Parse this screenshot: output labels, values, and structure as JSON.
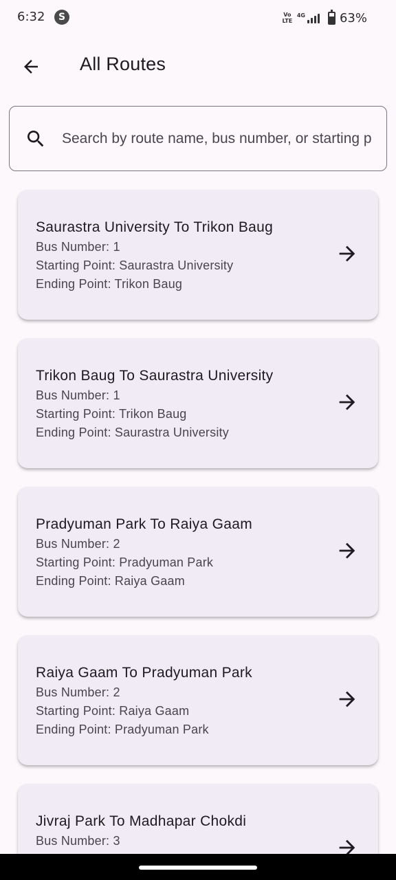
{
  "status_bar": {
    "time": "6:32",
    "app_icon_glyph": "S",
    "volte": "Vo LTE",
    "network_type": "4G",
    "battery_level": 0.63,
    "battery_text": "63%"
  },
  "app_bar": {
    "title": "All Routes",
    "back_icon": "arrow-left-icon"
  },
  "search": {
    "placeholder": "Search by route name, bus number, or starting point...",
    "value": "",
    "icon": "search-icon"
  },
  "routes": [
    {
      "name": "Saurastra University To Trikon Baug",
      "bus_number": "Bus Number: 1",
      "starting_point": "Starting Point: Saurastra University",
      "ending_point": "Ending Point: Trikon Baug"
    },
    {
      "name": "Trikon Baug To Saurastra University",
      "bus_number": "Bus Number: 1",
      "starting_point": "Starting Point: Trikon Baug",
      "ending_point": "Ending Point: Saurastra University"
    },
    {
      "name": "Pradyuman Park To Raiya Gaam",
      "bus_number": "Bus Number: 2",
      "starting_point": "Starting Point: Pradyuman Park",
      "ending_point": "Ending Point: Raiya Gaam"
    },
    {
      "name": "Raiya Gaam To Pradyuman Park",
      "bus_number": "Bus Number: 2",
      "starting_point": "Starting Point: Raiya Gaam",
      "ending_point": "Ending Point: Pradyuman Park"
    },
    {
      "name": "Jivraj Park To Madhapar Chokdi",
      "bus_number": "Bus Number: 3",
      "starting_point": "",
      "ending_point": ""
    }
  ],
  "colors": {
    "background": "#fdf8fc",
    "card": "#f0ebf4",
    "text_primary": "#1d1b20",
    "text_secondary": "#49454f",
    "outline": "#79747e"
  }
}
